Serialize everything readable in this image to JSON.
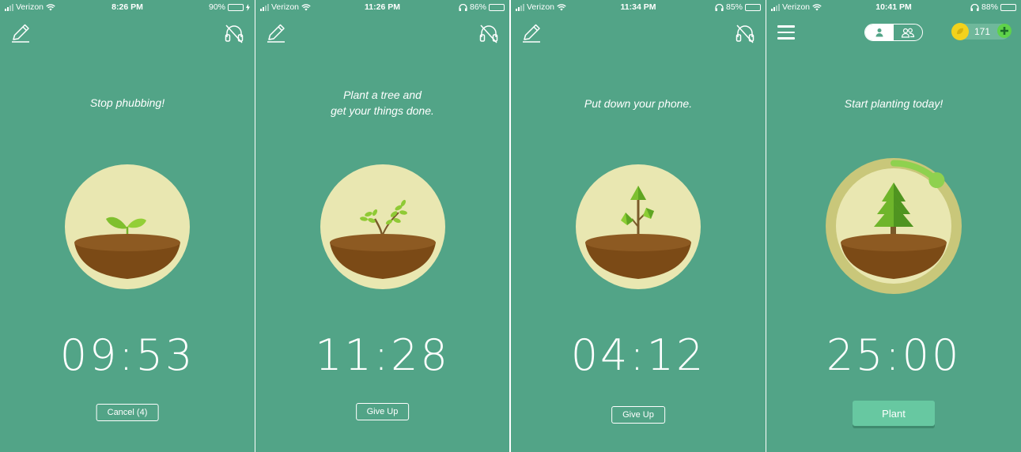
{
  "screens": [
    {
      "status": {
        "carrier": "Verizon",
        "time": "8:26 PM",
        "battery": "90%",
        "battery_level": 0.9,
        "battery_color": "#6ee35f"
      },
      "message": [
        "Stop phubbing!"
      ],
      "timer": "09:53",
      "button_label": "Cancel (4)",
      "icons": [
        "pencil-icon",
        "headphones-off-icon"
      ]
    },
    {
      "status": {
        "carrier": "Verizon",
        "time": "11:26 PM",
        "battery": "86%",
        "battery_level": 0.86
      },
      "message": [
        "Plant a tree and",
        "get your things done."
      ],
      "timer": "11:28",
      "button_label": "Give Up",
      "icons": [
        "pencil-icon",
        "headphones-off-icon"
      ]
    },
    {
      "status": {
        "carrier": "Verizon",
        "time": "11:34 PM",
        "battery": "85%",
        "battery_level": 0.85
      },
      "message": [
        "Put down your phone."
      ],
      "timer": "04:12",
      "button_label": "Give Up",
      "icons": [
        "pencil-icon",
        "headphones-off-icon"
      ]
    },
    {
      "status": {
        "carrier": "Verizon",
        "time": "10:41 PM",
        "battery": "88%",
        "battery_level": 0.88
      },
      "message": [
        "Start planting today!"
      ],
      "timer": "25:00",
      "button_label": "Plant",
      "coins": "171",
      "timer_ring_progress": 0.12,
      "icons": [
        "menu-icon",
        "single-user-icon",
        "group-icon",
        "coin-icon",
        "plus-icon"
      ]
    }
  ],
  "colors": {
    "background": "#52a487",
    "circle": "#e9e7b1",
    "soil": "#7b4a16",
    "soil_top": "#8d5a22",
    "ring": "#c9c77a",
    "ring_progress": "#8fd14f",
    "plant_button": "#67c8a1",
    "coin": "#f3d21c",
    "plus": "#5fd24a"
  }
}
